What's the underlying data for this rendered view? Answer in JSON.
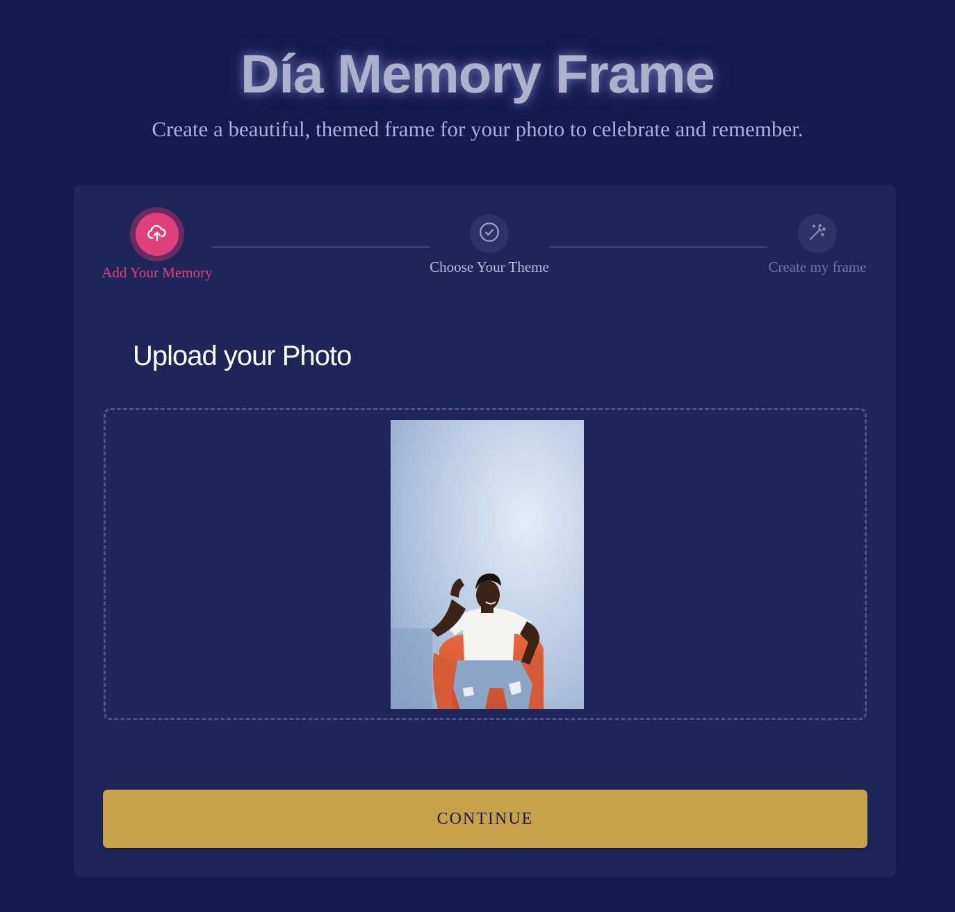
{
  "header": {
    "title": "Día Memory Frame",
    "subtitle": "Create a beautiful, themed frame for your photo to celebrate and remember."
  },
  "steps": [
    {
      "label": "Add Your Memory",
      "icon": "cloud-upload-icon",
      "state": "active"
    },
    {
      "label": "Choose Your Theme",
      "icon": "check-circle-icon",
      "state": "upcoming"
    },
    {
      "label": "Create my frame",
      "icon": "magic-wand-icon",
      "state": "disabled"
    }
  ],
  "upload": {
    "title": "Upload your Photo"
  },
  "actions": {
    "continue_label": "CONTINUE"
  },
  "colors": {
    "background": "#131a4d",
    "card": "#1e2659",
    "accent": "#e0407a",
    "button": "#c6a14a"
  }
}
